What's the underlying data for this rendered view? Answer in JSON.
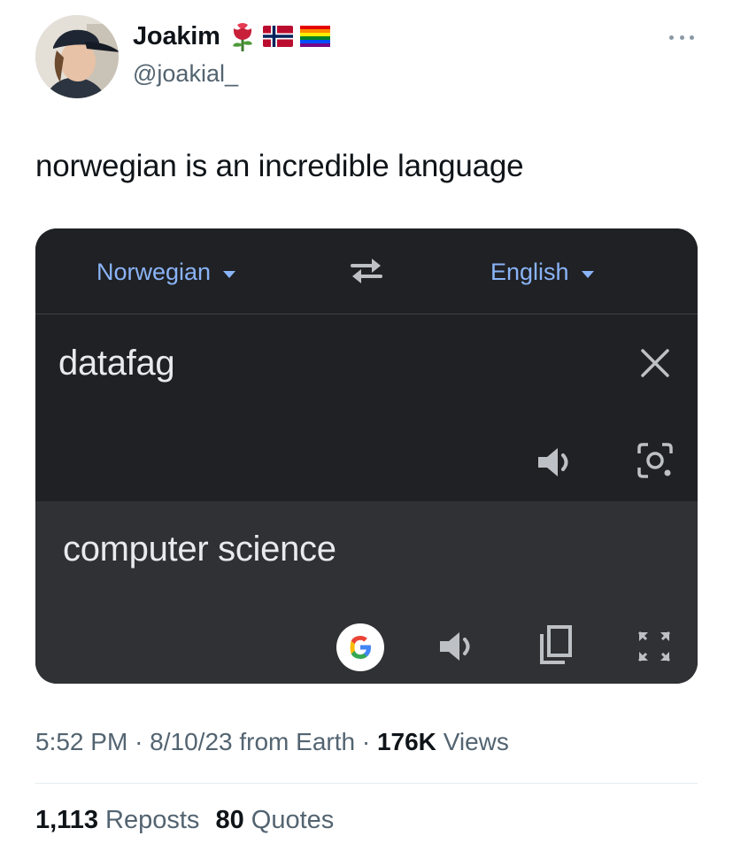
{
  "user": {
    "display_name": "Joakim",
    "handle": "@joakial_",
    "emoji_icons": [
      "rose-icon",
      "norway-flag-icon",
      "rainbow-flag-icon"
    ]
  },
  "tweet": {
    "text": "norwegian is an incredible language"
  },
  "translate": {
    "source_lang": "Norwegian",
    "target_lang": "English",
    "input_text": "datafag",
    "output_text": "computer science",
    "colors": {
      "background": "#202124",
      "output_background": "#303134",
      "accent": "#8ab4f8",
      "text": "#e8eaed"
    }
  },
  "meta": {
    "time": "5:52 PM",
    "date": "8/10/23",
    "source": "from Earth",
    "views_count": "176K",
    "views_label": "Views"
  },
  "stats": {
    "reposts_count": "1,113",
    "reposts_label": "Reposts",
    "quotes_count": "80",
    "quotes_label": "Quotes"
  }
}
